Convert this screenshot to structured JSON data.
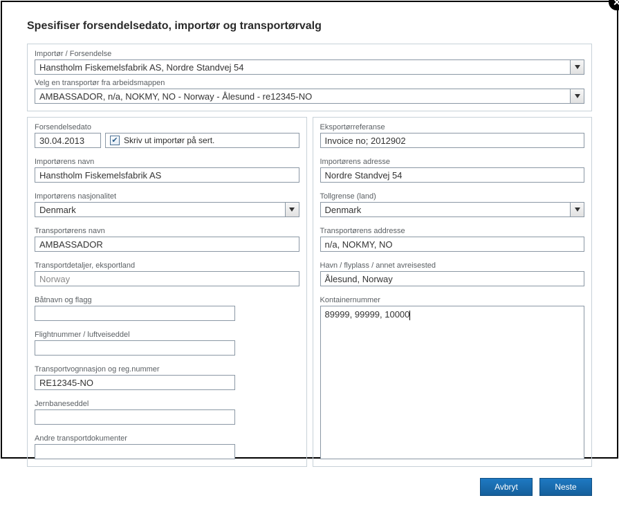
{
  "title": "Spesifiser forsendelsedato, importør og transportørvalg",
  "topSection": {
    "importerLabel": "Importør / Forsendelse",
    "importerValue": "Hanstholm Fiskemelsfabrik AS, Nordre Standvej 54",
    "transporterLabel": "Velg en transportør fra arbeidsmappen",
    "transporterValue": "AMBASSADOR, n/a, NOKMY, NO - Norway - Ålesund - re12345-NO"
  },
  "left": {
    "dateLabel": "Forsendelsedato",
    "dateValue": "30.04.2013",
    "printLabel": "Skriv ut importør på sert.",
    "printChecked": true,
    "impNameLabel": "Importørens navn",
    "impNameValue": "Hanstholm Fiskemelsfabrik AS",
    "impNatLabel": "Importørens nasjonalitet",
    "impNatValue": "Denmark",
    "transNameLabel": "Transportørens navn",
    "transNameValue": "AMBASSADOR",
    "transDetailLabel": "Transportdetaljer, eksportland",
    "transDetailValue": "Norway",
    "boatLabel": "Båtnavn og flagg",
    "boatValue": "",
    "flightLabel": "Flightnummer / luftveiseddel",
    "flightValue": "",
    "vehicleLabel": "Transportvognnasjon og reg.nummer",
    "vehicleValue": "RE12345-NO",
    "railLabel": "Jernbaneseddel",
    "railValue": "",
    "otherDocsLabel": "Andre transportdokumenter",
    "otherDocsValue": ""
  },
  "right": {
    "exportRefLabel": "Eksportørreferanse",
    "exportRefValue": "Invoice no; 2012902",
    "impAddrLabel": "Importørens adresse",
    "impAddrValue": "Nordre Standvej 54",
    "customsLabel": "Tollgrense (land)",
    "customsValue": "Denmark",
    "transAddrLabel": "Transportørens addresse",
    "transAddrValue": "n/a, NOKMY, NO",
    "portLabel": "Havn / flyplass / annet avreisested",
    "portValue": "Ålesund, Norway",
    "containerLabel": "Kontainernummer",
    "containerValue": "89999, 99999, 10000"
  },
  "footer": {
    "cancel": "Avbryt",
    "next": "Neste"
  }
}
